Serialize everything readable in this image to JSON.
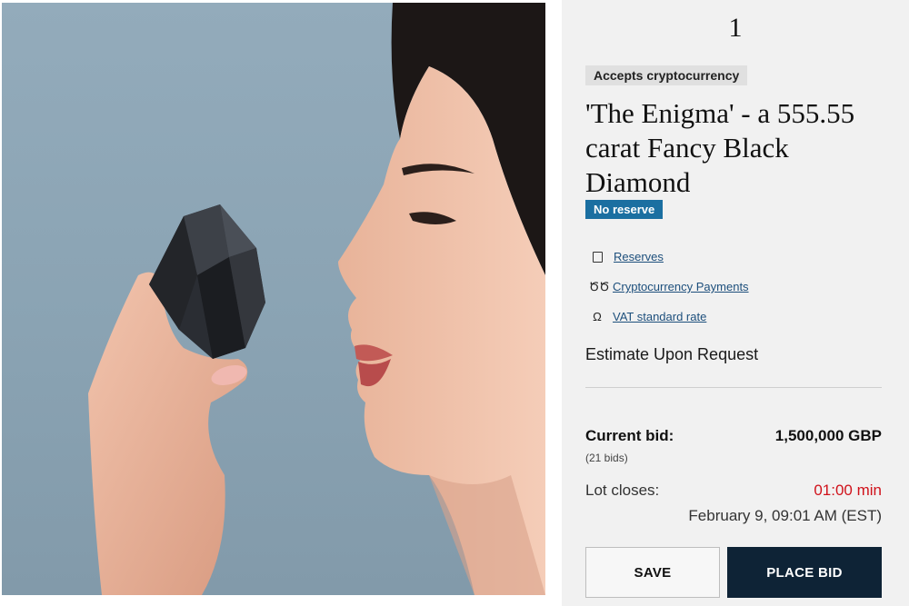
{
  "lot": {
    "number": "1",
    "crypto_tag": "Accepts cryptocurrency",
    "title": "'The Enigma' - a 555.55 carat Fancy Black Diamond",
    "no_reserve_badge": "No reserve",
    "links": [
      {
        "icon": "document-icon",
        "label": "Reserves"
      },
      {
        "icon": "crypto-icon",
        "glyph": "ԾԾ",
        "label": "Cryptocurrency Payments"
      },
      {
        "icon": "omega-icon",
        "glyph": "Ω",
        "label": "VAT standard rate"
      }
    ],
    "estimate": "Estimate Upon Request"
  },
  "bid": {
    "label": "Current bid:",
    "value": "1,500,000 GBP",
    "count": "(21 bids)"
  },
  "closing": {
    "label": "Lot closes:",
    "timer": "01:00 min",
    "date": "February 9, 09:01 AM (EST)"
  },
  "actions": {
    "save": "SAVE",
    "place_bid": "PLACE BID"
  },
  "colors": {
    "badge_blue": "#1b6fa1",
    "link_blue": "#1d4f7c",
    "timer_red": "#d0121b",
    "primary_button": "#0e2336",
    "panel_bg": "#f1f1f1"
  }
}
